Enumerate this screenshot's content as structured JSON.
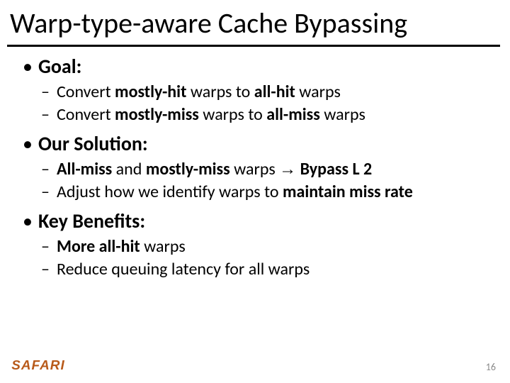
{
  "title": "Warp-type-aware Cache Bypassing",
  "sections": {
    "goal": {
      "heading": "Goal:",
      "items": [
        {
          "pre": "Convert ",
          "b1": "mostly-hit",
          "mid": " warps to ",
          "b2": "all-hit",
          "post": " warps"
        },
        {
          "pre": "Convert ",
          "b1": "mostly-miss",
          "mid": " warps to ",
          "b2": "all-miss",
          "post": " warps"
        }
      ]
    },
    "solution": {
      "heading": "Our Solution:",
      "items": [
        {
          "b1": "All-miss",
          "mid1": " and ",
          "b2": "mostly-miss",
          "mid2": " warps ",
          "arrow": "→",
          "mid3": " ",
          "b3": "Bypass L 2"
        },
        {
          "pre": "Adjust how we identify warps to ",
          "b1": "maintain miss rate"
        }
      ]
    },
    "benefits": {
      "heading": "Key Benefits:",
      "items": [
        {
          "b1": "More all-hit",
          "post": " warps"
        },
        {
          "pre": "Reduce queuing latency for all warps"
        }
      ]
    }
  },
  "footer": {
    "logo": "SAFARI",
    "page": "16"
  }
}
